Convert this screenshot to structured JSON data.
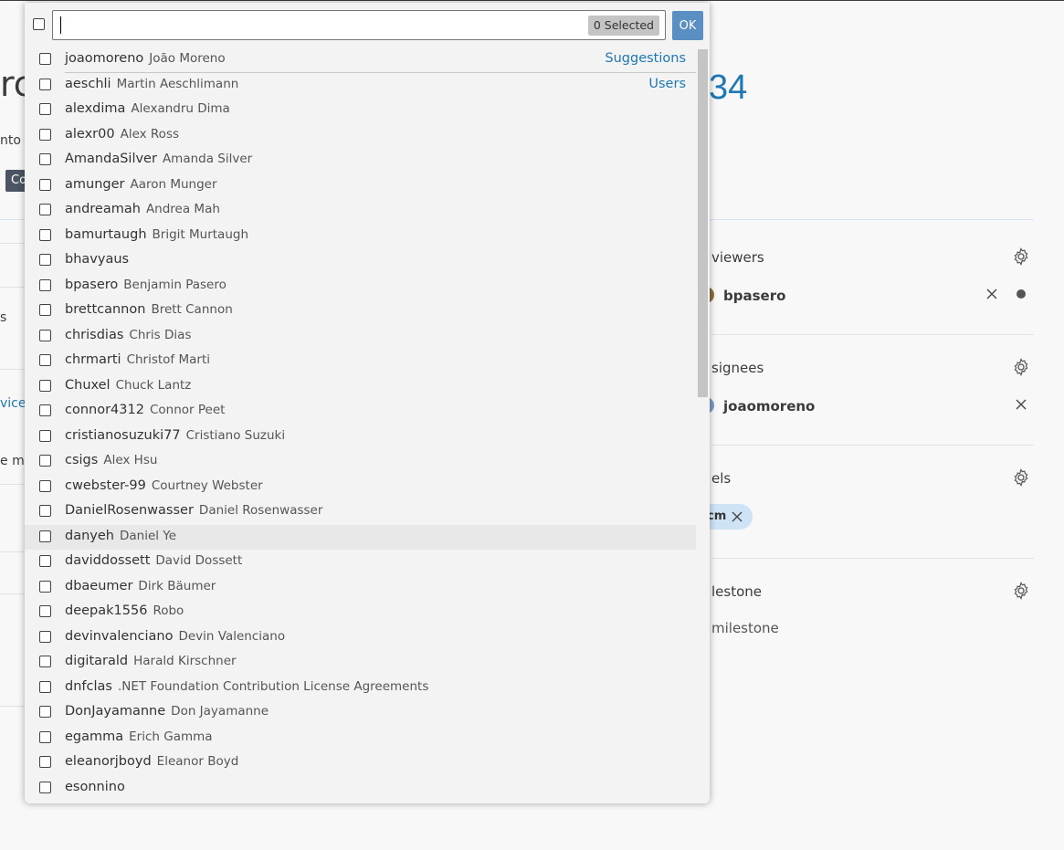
{
  "background": {
    "title_fragment": "rc",
    "issue_number_fragment": "34",
    "into_text": "nto",
    "badge_text": "Co",
    "side_texts": [
      "s",
      "vice",
      "e m"
    ],
    "sidebar": {
      "reviewers_title": "viewers",
      "reviewer": "bpasero",
      "assignees_title": "signees",
      "assignee": "joaomoreno",
      "labels_title": "els",
      "label_chip": "cm",
      "milestone_title": "lestone",
      "milestone_value": "milestone"
    }
  },
  "picker": {
    "input_value": "",
    "selected_badge": "0 Selected",
    "ok_label": "OK",
    "groups": {
      "suggestions": "Suggestions",
      "users": "Users"
    },
    "items": [
      {
        "login": "joaomoreno",
        "name": "João Moreno"
      },
      {
        "login": "aeschli",
        "name": "Martin Aeschlimann"
      },
      {
        "login": "alexdima",
        "name": "Alexandru Dima"
      },
      {
        "login": "alexr00",
        "name": "Alex Ross"
      },
      {
        "login": "AmandaSilver",
        "name": "Amanda Silver"
      },
      {
        "login": "amunger",
        "name": "Aaron Munger"
      },
      {
        "login": "andreamah",
        "name": "Andrea Mah"
      },
      {
        "login": "bamurtaugh",
        "name": "Brigit Murtaugh"
      },
      {
        "login": "bhavyaus",
        "name": ""
      },
      {
        "login": "bpasero",
        "name": "Benjamin Pasero"
      },
      {
        "login": "brettcannon",
        "name": "Brett Cannon"
      },
      {
        "login": "chrisdias",
        "name": "Chris Dias"
      },
      {
        "login": "chrmarti",
        "name": "Christof Marti"
      },
      {
        "login": "Chuxel",
        "name": "Chuck Lantz"
      },
      {
        "login": "connor4312",
        "name": "Connor Peet"
      },
      {
        "login": "cristianosuzuki77",
        "name": "Cristiano Suzuki"
      },
      {
        "login": "csigs",
        "name": "Alex Hsu"
      },
      {
        "login": "cwebster-99",
        "name": "Courtney Webster"
      },
      {
        "login": "DanielRosenwasser",
        "name": "Daniel Rosenwasser"
      },
      {
        "login": "danyeh",
        "name": "Daniel Ye"
      },
      {
        "login": "daviddossett",
        "name": "David Dossett"
      },
      {
        "login": "dbaeumer",
        "name": "Dirk Bäumer"
      },
      {
        "login": "deepak1556",
        "name": "Robo"
      },
      {
        "login": "devinvalenciano",
        "name": "Devin Valenciano"
      },
      {
        "login": "digitarald",
        "name": "Harald Kirschner"
      },
      {
        "login": "dnfclas",
        "name": ".NET Foundation Contribution License Agreements"
      },
      {
        "login": "DonJayamanne",
        "name": "Don Jayamanne"
      },
      {
        "login": "egamma",
        "name": "Erich Gamma"
      },
      {
        "login": "eleanorjboyd",
        "name": "Eleanor Boyd"
      },
      {
        "login": "esonnino",
        "name": ""
      }
    ]
  }
}
